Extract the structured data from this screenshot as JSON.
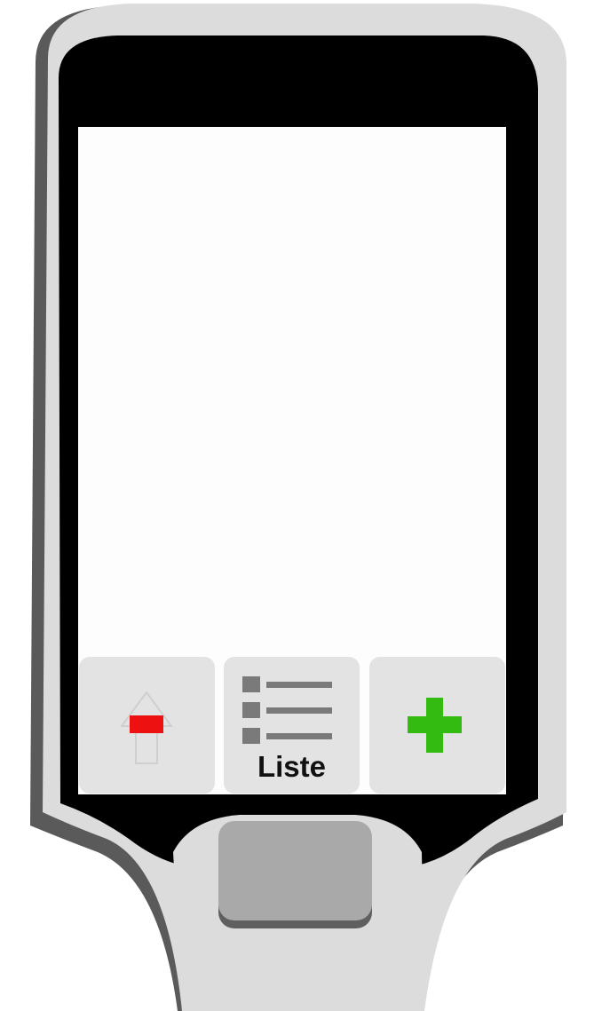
{
  "device": {
    "body_color": "#dcdcdc",
    "shadow_color": "#5a5a5a",
    "bezel_color": "#000000",
    "screen_color": "#fdfdfd"
  },
  "softkeys": {
    "minus": {
      "icon": "minus-icon",
      "icon_color": "#ee1111",
      "ghost_icon": "up-arrow-icon"
    },
    "list": {
      "icon": "list-icon",
      "label": "Liste"
    },
    "plus": {
      "icon": "plus-icon",
      "icon_color": "#33bb11"
    }
  },
  "hardware_button": {
    "icon": "hardware-button",
    "color": "#a9a9a9"
  }
}
